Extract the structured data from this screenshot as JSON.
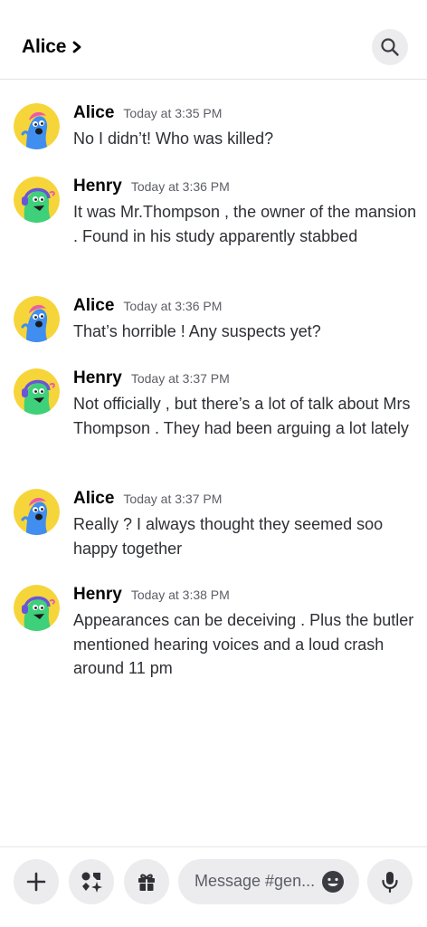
{
  "header": {
    "channel_name": "Alice",
    "chevron_icon": "chevron-right-icon",
    "search_icon": "search-icon"
  },
  "messages": [
    {
      "author": "Alice",
      "time": "Today at 3:35 PM",
      "text": "No I didn’t! Who was killed?",
      "avatar": "alice-avatar"
    },
    {
      "author": "Henry",
      "time": "Today at 3:36 PM",
      "text": "It was Mr.Thompson , the owner of the mansion . Found in his study apparently stabbed",
      "avatar": "henry-avatar"
    },
    {
      "author": "Alice",
      "time": "Today at 3:36 PM",
      "text": "That’s horrible ! Any suspects yet?",
      "avatar": "alice-avatar"
    },
    {
      "author": "Henry",
      "time": "Today at 3:37 PM",
      "text": "Not officially , but there’s a lot of talk about Mrs Thompson . They had been arguing a lot lately",
      "avatar": "henry-avatar"
    },
    {
      "author": "Alice",
      "time": "Today at 3:37 PM",
      "text": "Really ? I always thought they seemed soo happy together",
      "avatar": "alice-avatar"
    },
    {
      "author": "Henry",
      "time": "Today at 3:38 PM",
      "text": "Appearances can be deceiving . Plus the butler mentioned hearing voices and a loud crash around 11 pm",
      "avatar": "henry-avatar"
    }
  ],
  "composer": {
    "placeholder": "Message #gen...",
    "buttons": [
      "plus-icon",
      "apps-icon",
      "gift-icon",
      "emoji-icon",
      "microphone-icon"
    ]
  },
  "colors": {
    "alice_avatar_bg": "#f6d53a",
    "alice_body": "#3f8ef0",
    "alice_hair": "#ee5aa6",
    "henry_avatar_bg": "#f6d53a",
    "henry_body": "#3ed07a",
    "henry_headphones": "#6a55d8",
    "control_bg": "#ececef"
  }
}
